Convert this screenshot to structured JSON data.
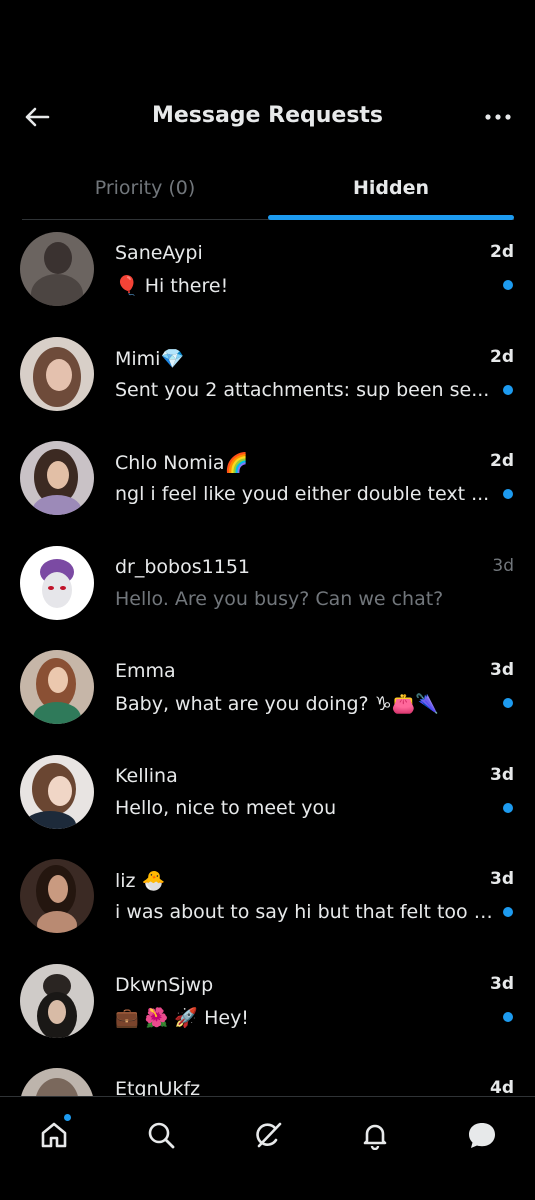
{
  "header": {
    "title": "Message Requests",
    "back_icon": "arrow-left-icon",
    "more_icon": "more-horizontal-icon"
  },
  "tabs": [
    {
      "label": "Priority (0)",
      "active": false
    },
    {
      "label": "Hidden",
      "active": true
    }
  ],
  "conversations": [
    {
      "name": "SaneAypi",
      "message": "🎈 Hi there!",
      "time": "2d",
      "unread": true,
      "avatar_color": "#6b6460"
    },
    {
      "name": "Mimi💎",
      "message": "Sent you 2 attachments: sup been se...",
      "time": "2d",
      "unread": true,
      "avatar_color": "#b28a76"
    },
    {
      "name": "Chlo Nomia🌈",
      "message": "ngl i feel like youd either double text ...",
      "time": "2d",
      "unread": true,
      "avatar_color": "#8a7c86"
    },
    {
      "name": "dr_bobos1151",
      "message": "Hello. Are you busy? Can we chat?",
      "time": "3d",
      "unread": false,
      "avatar_color": "#ffffff"
    },
    {
      "name": "Emma",
      "message": "Baby, what are you doing? ♑👛🌂",
      "time": "3d",
      "unread": true,
      "avatar_color": "#9c7a60"
    },
    {
      "name": "Kellina",
      "message": "Hello, nice to meet you",
      "time": "3d",
      "unread": true,
      "avatar_color": "#cfc7c3"
    },
    {
      "name": "liz 🐣",
      "message": "i was about to say hi but that felt too l...",
      "time": "3d",
      "unread": true,
      "avatar_color": "#5e4a40"
    },
    {
      "name": "DkwnSjwp",
      "message": "💼 🌺 🚀 Hey!",
      "time": "3d",
      "unread": true,
      "avatar_color": "#8d8d8d"
    },
    {
      "name": "EtgnUkfz",
      "message": "",
      "time": "4d",
      "unread": false,
      "avatar_color": "#a29a92"
    }
  ],
  "bottom_nav": [
    {
      "icon": "home-icon",
      "notification": true
    },
    {
      "icon": "search-icon",
      "notification": false
    },
    {
      "icon": "grok-icon",
      "notification": false
    },
    {
      "icon": "bell-icon",
      "notification": false
    },
    {
      "icon": "messages-icon",
      "notification": false
    }
  ],
  "colors": {
    "accent": "#1d9bf0",
    "background": "#000000",
    "text_primary": "#e7e9ea",
    "text_secondary": "#71767b",
    "divider": "#2f3336"
  }
}
